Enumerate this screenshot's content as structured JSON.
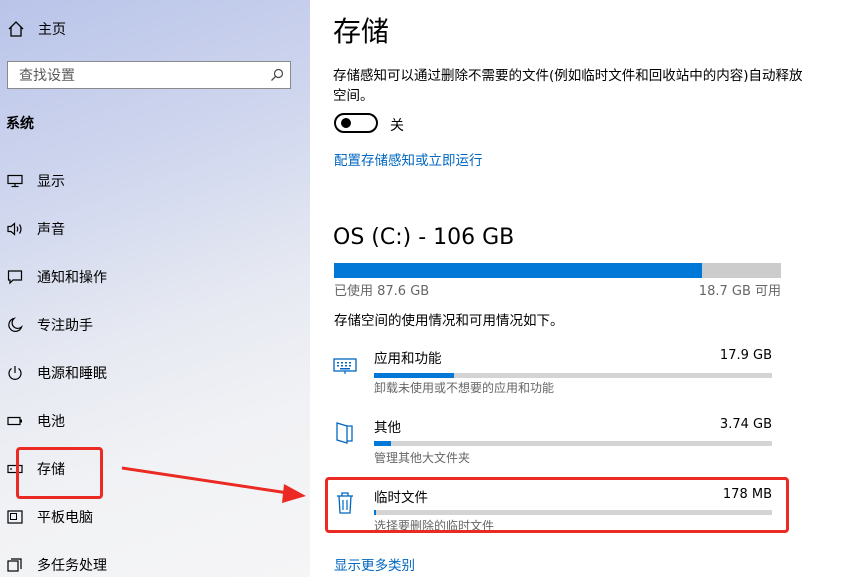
{
  "sidebar": {
    "home_label": "主页",
    "search_placeholder": "查找设置",
    "section_label": "系统",
    "items": [
      {
        "label": "显示",
        "icon": "display-icon"
      },
      {
        "label": "声音",
        "icon": "sound-icon"
      },
      {
        "label": "通知和操作",
        "icon": "notification-icon"
      },
      {
        "label": "专注助手",
        "icon": "moon-icon"
      },
      {
        "label": "电源和睡眠",
        "icon": "power-icon"
      },
      {
        "label": "电池",
        "icon": "battery-icon"
      },
      {
        "label": "存储",
        "icon": "storage-icon",
        "selected": true
      },
      {
        "label": "平板电脑",
        "icon": "tablet-icon"
      },
      {
        "label": "多任务处理",
        "icon": "multitask-icon"
      }
    ]
  },
  "main": {
    "title": "存储",
    "storage_sense_desc": "存储感知可以通过删除不需要的文件(例如临时文件和回收站中的内容)自动释放空间。",
    "toggle_state": "关",
    "configure_link": "配置存储感知或立即运行",
    "drive": {
      "title": "OS (C:) - 106 GB",
      "used_label": "已使用 87.6 GB",
      "free_label": "18.7 GB 可用",
      "used_fraction": 0.824,
      "usage_description": "存储空间的使用情况和可用情况如下。"
    },
    "categories": [
      {
        "name": "应用和功能",
        "size": "17.9 GB",
        "fraction": 0.2,
        "desc": "卸载未使用或不想要的应用和功能",
        "icon": "keyboard-icon"
      },
      {
        "name": "其他",
        "size": "3.74 GB",
        "fraction": 0.042,
        "desc": "管理其他大文件夹",
        "icon": "folder-icon"
      },
      {
        "name": "临时文件",
        "size": "178 MB",
        "fraction": 0.003,
        "desc": "选择要删除的临时文件",
        "icon": "trash-icon"
      }
    ],
    "show_more_link": "显示更多类别"
  },
  "colors": {
    "accent": "#0078d7",
    "link": "#0067c0",
    "annotation": "#ea2a23"
  }
}
